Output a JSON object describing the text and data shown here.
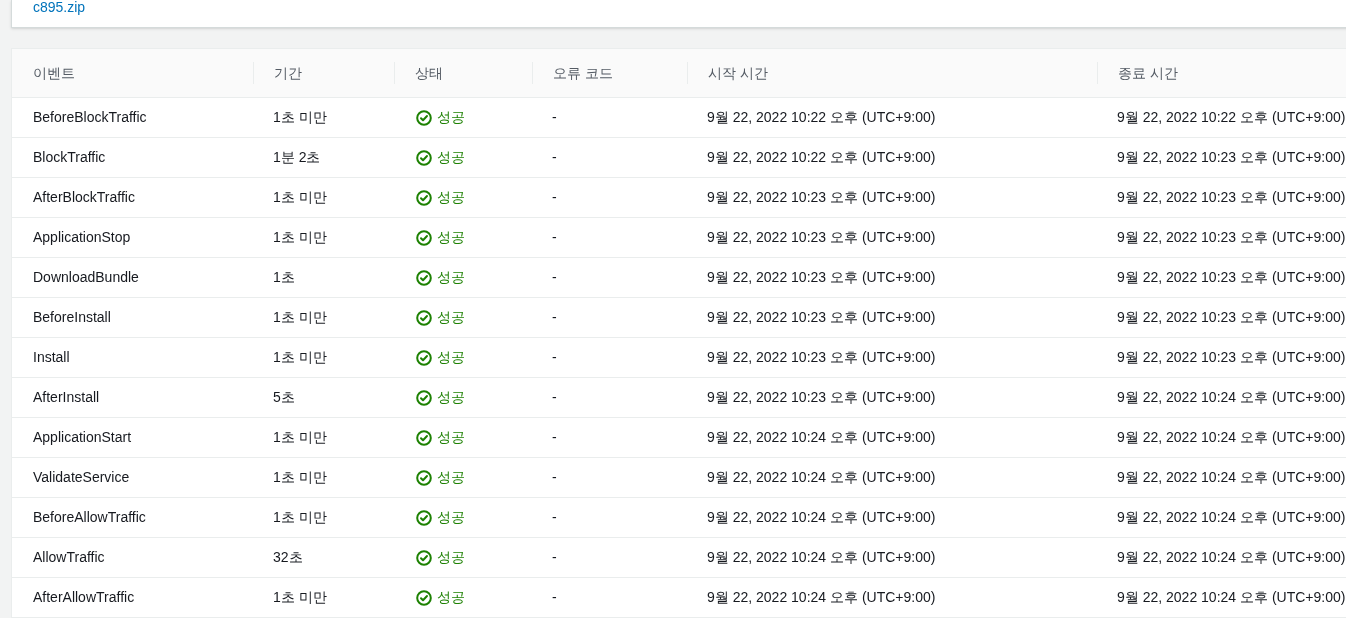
{
  "top_card": {
    "link": "c895.zip"
  },
  "table": {
    "columns": [
      "이벤트",
      "기간",
      "상태",
      "오류 코드",
      "시작 시간",
      "종료 시간"
    ],
    "rows": [
      {
        "event": "BeforeBlockTraffic",
        "duration": "1초 미만",
        "status": {
          "kind": "success",
          "label": "성공"
        },
        "error_code": "-",
        "start": "9월 22, 2022 10:22 오후 (UTC+9:00)",
        "end": "9월 22, 2022 10:22 오후 (UTC+9:00)"
      },
      {
        "event": "BlockTraffic",
        "duration": "1분 2초",
        "status": {
          "kind": "success",
          "label": "성공"
        },
        "error_code": "-",
        "start": "9월 22, 2022 10:22 오후 (UTC+9:00)",
        "end": "9월 22, 2022 10:23 오후 (UTC+9:00)"
      },
      {
        "event": "AfterBlockTraffic",
        "duration": "1초 미만",
        "status": {
          "kind": "success",
          "label": "성공"
        },
        "error_code": "-",
        "start": "9월 22, 2022 10:23 오후 (UTC+9:00)",
        "end": "9월 22, 2022 10:23 오후 (UTC+9:00)"
      },
      {
        "event": "ApplicationStop",
        "duration": "1초 미만",
        "status": {
          "kind": "success",
          "label": "성공"
        },
        "error_code": "-",
        "start": "9월 22, 2022 10:23 오후 (UTC+9:00)",
        "end": "9월 22, 2022 10:23 오후 (UTC+9:00)"
      },
      {
        "event": "DownloadBundle",
        "duration": "1초",
        "status": {
          "kind": "success",
          "label": "성공"
        },
        "error_code": "-",
        "start": "9월 22, 2022 10:23 오후 (UTC+9:00)",
        "end": "9월 22, 2022 10:23 오후 (UTC+9:00)"
      },
      {
        "event": "BeforeInstall",
        "duration": "1초 미만",
        "status": {
          "kind": "success",
          "label": "성공"
        },
        "error_code": "-",
        "start": "9월 22, 2022 10:23 오후 (UTC+9:00)",
        "end": "9월 22, 2022 10:23 오후 (UTC+9:00)"
      },
      {
        "event": "Install",
        "duration": "1초 미만",
        "status": {
          "kind": "success",
          "label": "성공"
        },
        "error_code": "-",
        "start": "9월 22, 2022 10:23 오후 (UTC+9:00)",
        "end": "9월 22, 2022 10:23 오후 (UTC+9:00)"
      },
      {
        "event": "AfterInstall",
        "duration": "5초",
        "status": {
          "kind": "success",
          "label": "성공"
        },
        "error_code": "-",
        "start": "9월 22, 2022 10:23 오후 (UTC+9:00)",
        "end": "9월 22, 2022 10:24 오후 (UTC+9:00)"
      },
      {
        "event": "ApplicationStart",
        "duration": "1초 미만",
        "status": {
          "kind": "success",
          "label": "성공"
        },
        "error_code": "-",
        "start": "9월 22, 2022 10:24 오후 (UTC+9:00)",
        "end": "9월 22, 2022 10:24 오후 (UTC+9:00)"
      },
      {
        "event": "ValidateService",
        "duration": "1초 미만",
        "status": {
          "kind": "success",
          "label": "성공"
        },
        "error_code": "-",
        "start": "9월 22, 2022 10:24 오후 (UTC+9:00)",
        "end": "9월 22, 2022 10:24 오후 (UTC+9:00)"
      },
      {
        "event": "BeforeAllowTraffic",
        "duration": "1초 미만",
        "status": {
          "kind": "success",
          "label": "성공"
        },
        "error_code": "-",
        "start": "9월 22, 2022 10:24 오후 (UTC+9:00)",
        "end": "9월 22, 2022 10:24 오후 (UTC+9:00)"
      },
      {
        "event": "AllowTraffic",
        "duration": "32초",
        "status": {
          "kind": "success",
          "label": "성공"
        },
        "error_code": "-",
        "start": "9월 22, 2022 10:24 오후 (UTC+9:00)",
        "end": "9월 22, 2022 10:24 오후 (UTC+9:00)"
      },
      {
        "event": "AfterAllowTraffic",
        "duration": "1초 미만",
        "status": {
          "kind": "success",
          "label": "성공"
        },
        "error_code": "-",
        "start": "9월 22, 2022 10:24 오후 (UTC+9:00)",
        "end": "9월 22, 2022 10:24 오후 (UTC+9:00)"
      }
    ]
  }
}
